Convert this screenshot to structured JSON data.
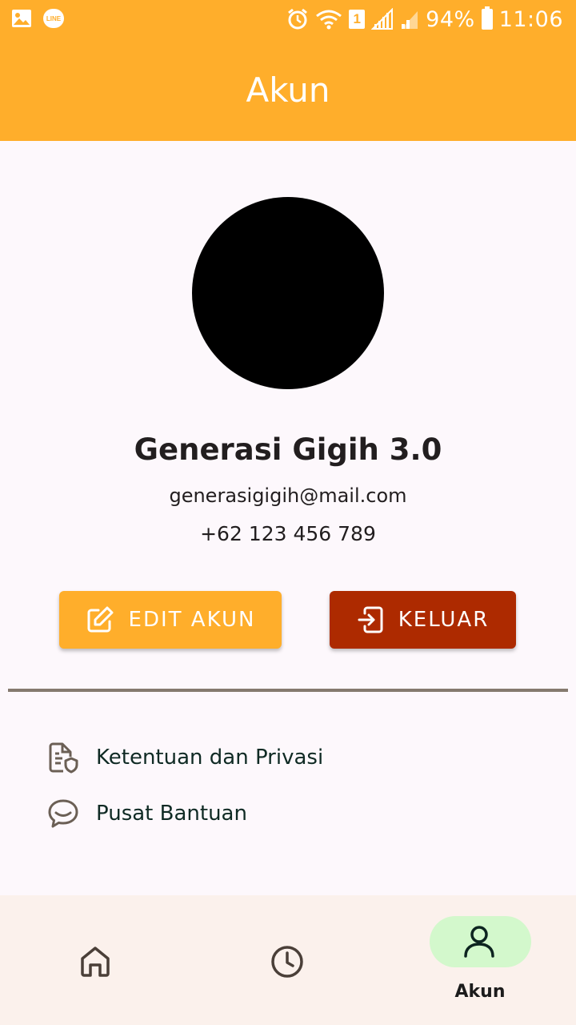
{
  "status_bar": {
    "left_icons": [
      "image-icon",
      "line-app-icon"
    ],
    "line_badge": "LINE",
    "right_icons": [
      "alarm-icon",
      "wifi-icon",
      "sim-icon",
      "signal-icon",
      "signal-2-icon",
      "battery-icon"
    ],
    "sim_number": "1",
    "battery": "94%",
    "time": "11:06"
  },
  "app_bar": {
    "title": "Akun"
  },
  "profile": {
    "name": "Generasi Gigih 3.0",
    "email": "generasigigih@mail.com",
    "phone": "+62 123 456 789"
  },
  "actions": {
    "edit_label": "EDIT AKUN",
    "logout_label": "KELUAR"
  },
  "menu": [
    {
      "label": "Ketentuan dan Privasi",
      "icon": "document-shield-icon"
    },
    {
      "label": "Pusat Bantuan",
      "icon": "chat-bubble-icon"
    }
  ],
  "bottom_nav": {
    "items": [
      {
        "icon": "home-icon",
        "label": ""
      },
      {
        "icon": "clock-icon",
        "label": ""
      },
      {
        "icon": "person-icon",
        "label": "Akun",
        "active": true
      }
    ]
  },
  "colors": {
    "primary": "#ffae2b",
    "logout": "#ad2a00",
    "active_pill": "#d3f8cc",
    "background": "#fdf8fc",
    "nav_background": "#fbf1ec"
  }
}
